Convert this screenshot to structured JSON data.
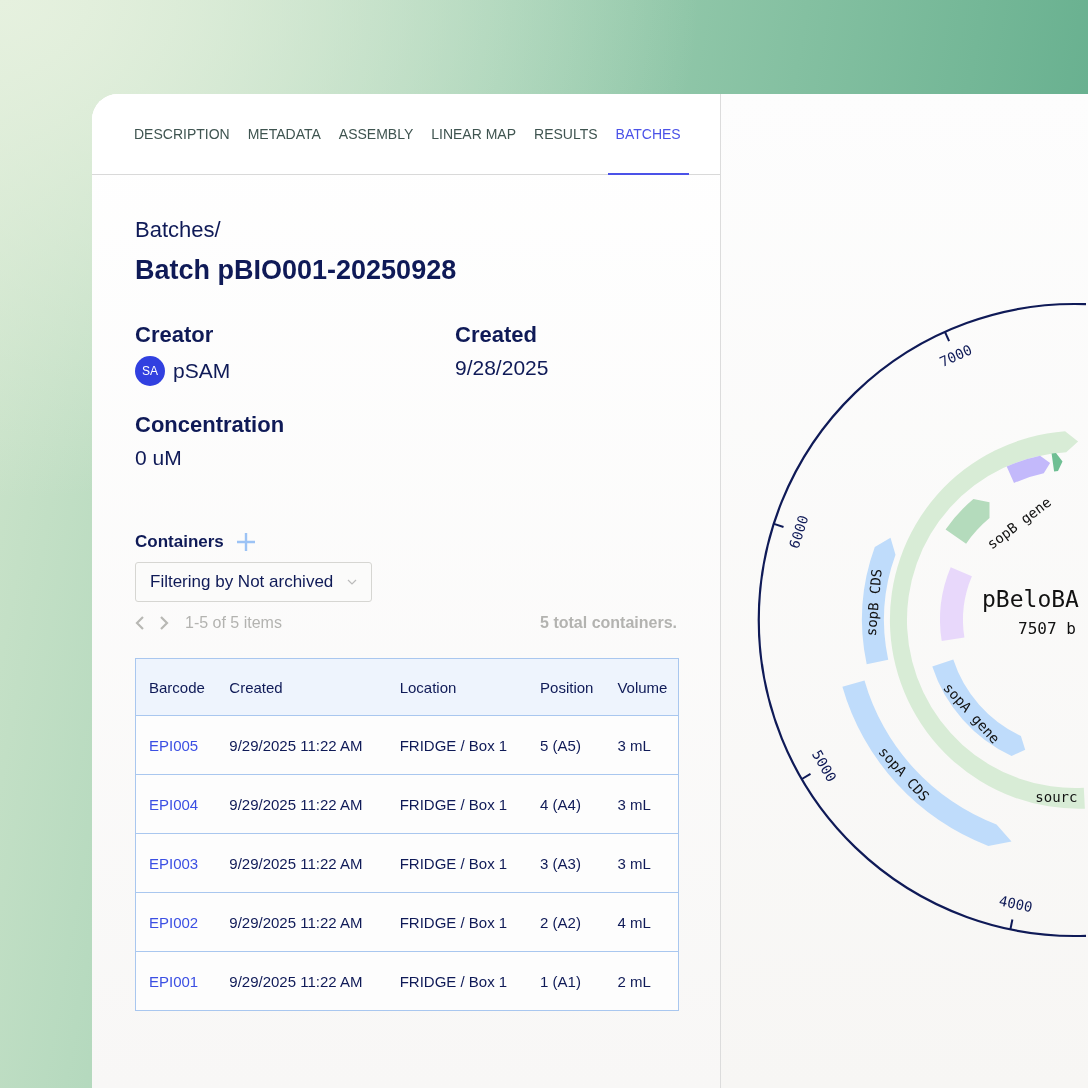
{
  "tabs": [
    {
      "label": "DESCRIPTION",
      "selected": false
    },
    {
      "label": "METADATA",
      "selected": false
    },
    {
      "label": "ASSEMBLY",
      "selected": false
    },
    {
      "label": "LINEAR MAP",
      "selected": false
    },
    {
      "label": "RESULTS",
      "selected": false
    },
    {
      "label": "BATCHES",
      "selected": true
    }
  ],
  "breadcrumb": "Batches/",
  "title": "Batch pBIO001-20250928",
  "fields": [
    {
      "label": "Creator",
      "avatar": "SA",
      "value": "pSAM"
    },
    {
      "label": "Created",
      "value": "9/28/2025"
    },
    {
      "label": "Concentration",
      "value": "0 uM"
    }
  ],
  "containers": {
    "heading": "Containers",
    "filter": "Filtering by Not archived",
    "range": "1-5 of 5 items",
    "total": "5 total containers.",
    "columns": [
      "Barcode",
      "Created",
      "Location",
      "Position",
      "Volume"
    ],
    "rows": [
      [
        "EPI005",
        "9/29/2025 11:22 AM",
        "FRIDGE / Box 1",
        "5 (A5)",
        "3 mL"
      ],
      [
        "EPI004",
        "9/29/2025 11:22 AM",
        "FRIDGE / Box 1",
        "4 (A4)",
        "3 mL"
      ],
      [
        "EPI003",
        "9/29/2025 11:22 AM",
        "FRIDGE / Box 1",
        "3 (A3)",
        "3 mL"
      ],
      [
        "EPI002",
        "9/29/2025 11:22 AM",
        "FRIDGE / Box 1",
        "2 (A2)",
        "4 mL"
      ],
      [
        "EPI001",
        "9/29/2025 11:22 AM",
        "FRIDGE / Box 1",
        "1 (A1)",
        "2 mL"
      ]
    ]
  },
  "plasmid_map": {
    "name": "pBeloBA",
    "length": "7507 b",
    "ticks": [
      "7000",
      "6000",
      "5000",
      "4000"
    ],
    "features": [
      {
        "label": "sopA CDS",
        "color": "#bfdcfb"
      },
      {
        "label": "sopB CDS",
        "color": "#bfdcfb"
      },
      {
        "label": "sourc",
        "color": "#d8ecd6"
      },
      {
        "label": "sopA gene",
        "color": "#bfdcfb"
      },
      {
        "label": "sopB gene",
        "color": "#b4dbbc"
      },
      {
        "color": "#e8d8fb"
      },
      {
        "color": "#c3b9fb"
      },
      {
        "color": "#6fbf93"
      }
    ]
  }
}
